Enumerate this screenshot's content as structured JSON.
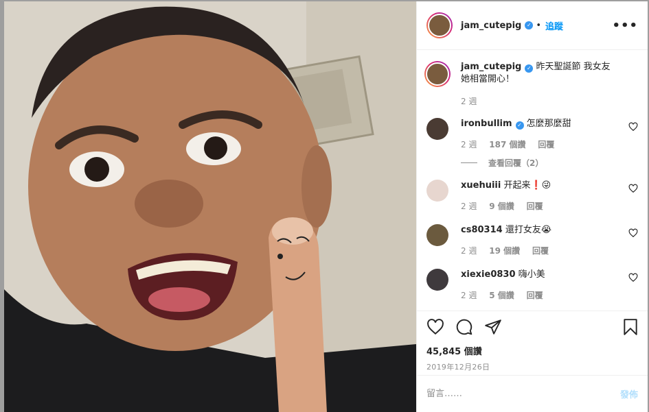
{
  "post": {
    "username": "jam_cutepig",
    "follow_label": "追蹤",
    "more_icon": "more-options-icon",
    "caption": "昨天聖誕節 我女友她相當開心！",
    "caption_time": "2 週",
    "likes": "45,845 個讚",
    "date": "2019年12月26日"
  },
  "comments": [
    {
      "username": "ironbullim",
      "verified": true,
      "text": "怎麼那麼甜",
      "time": "2 週",
      "likes": "187 個讚",
      "reply": "回覆",
      "view_replies": "查看回覆（2）"
    },
    {
      "username": "xuehuiii",
      "text": "开起来❗😜",
      "time": "2 週",
      "likes": "9 個讚",
      "reply": "回覆"
    },
    {
      "username": "cs80314",
      "text": "還打女友😭",
      "time": "2 週",
      "likes": "19 個讚",
      "reply": "回覆"
    },
    {
      "username": "xiexie0830",
      "text": "嗨小美",
      "time": "2 週",
      "likes": "5 個讚",
      "reply": "回覆"
    }
  ],
  "composer": {
    "placeholder": "留言……",
    "post_label": "發佈"
  },
  "icons": {
    "like": "heart-icon",
    "comment": "comment-icon",
    "share": "share-icon",
    "save": "bookmark-icon"
  },
  "colors": {
    "accent": "#0095f6",
    "verified": "#3897f0",
    "muted": "#8e8e8e"
  }
}
